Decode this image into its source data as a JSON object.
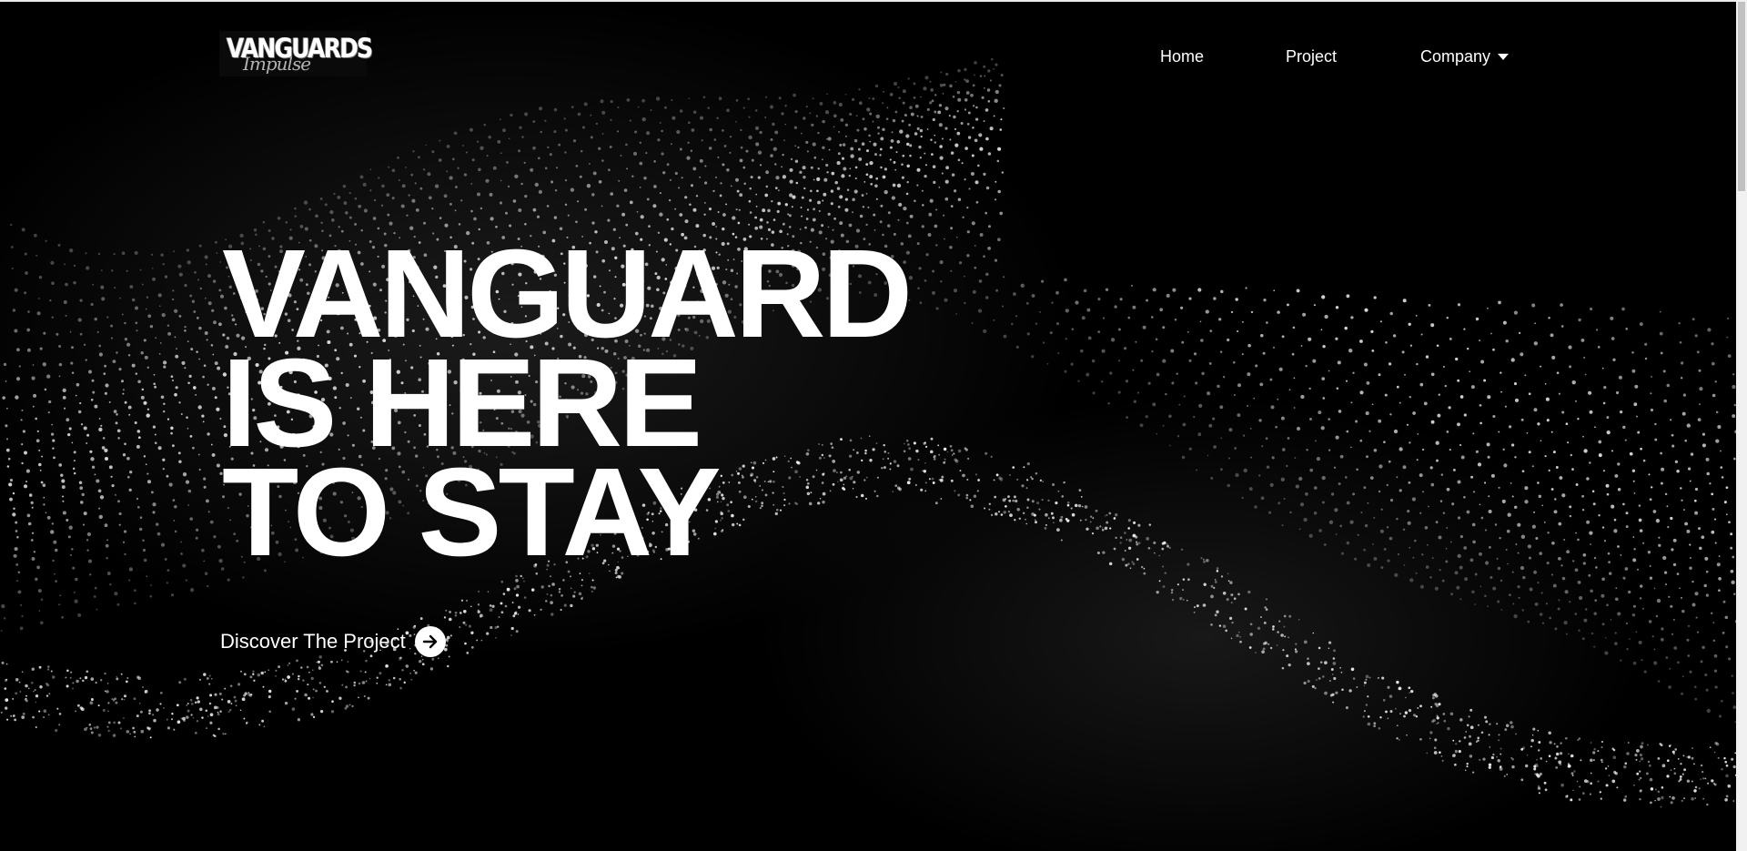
{
  "logo": {
    "main_text": "VANGUARDS",
    "script_text": "Impulse"
  },
  "nav": {
    "home": "Home",
    "project": "Project",
    "company": "Company"
  },
  "hero": {
    "line1": "VANGUARD",
    "line2": "IS HERE",
    "line3": "TO STAY"
  },
  "cta": {
    "label": "Discover The Project",
    "icon": "arrow-right-icon"
  },
  "colors": {
    "background": "#000000",
    "text": "#ffffff",
    "scrollbar_track": "#f1f1f1",
    "scrollbar_thumb": "#c1c1c1"
  }
}
